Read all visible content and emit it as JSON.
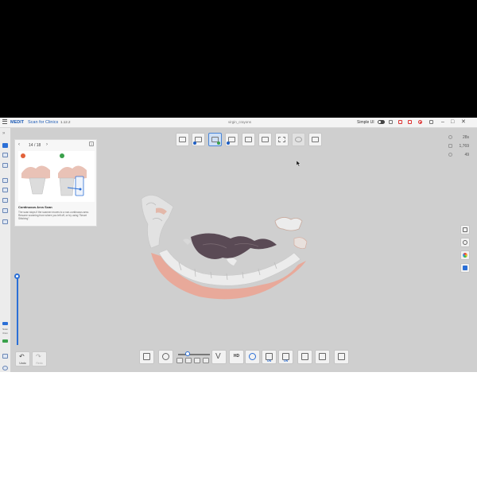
{
  "titlebar": {
    "brand": "MEDIT",
    "brand_sub": "Scan for Clinics",
    "version": "1.12.2",
    "document": "virgin_crayons",
    "simple_ui_label": "Simple UI"
  },
  "tutorial": {
    "page": "14 / 18",
    "help": "?",
    "title": "Continuous Arcs Scan",
    "description": "The scan stops if the scanner moves to a non-continuous area. Resume scanning from where you left off, or try using \"Smart Stitching\"."
  },
  "stats": {
    "fps": "28s",
    "count": "1,769",
    "value": "49"
  },
  "left_sidebar": {
    "bottom_label_1": "Scan",
    "bottom_label_2": "3mm"
  },
  "history": {
    "undo": "Undo",
    "redo": "Redo"
  },
  "bottom_toolbar": {
    "hd_label": "HD",
    "color_label": "ON",
    "pay_label": "ON"
  },
  "colors": {
    "accent": "#2b6fd6",
    "gum": "#e8a99a",
    "tooth": "#efefef",
    "tissue": "#5a4a55"
  }
}
